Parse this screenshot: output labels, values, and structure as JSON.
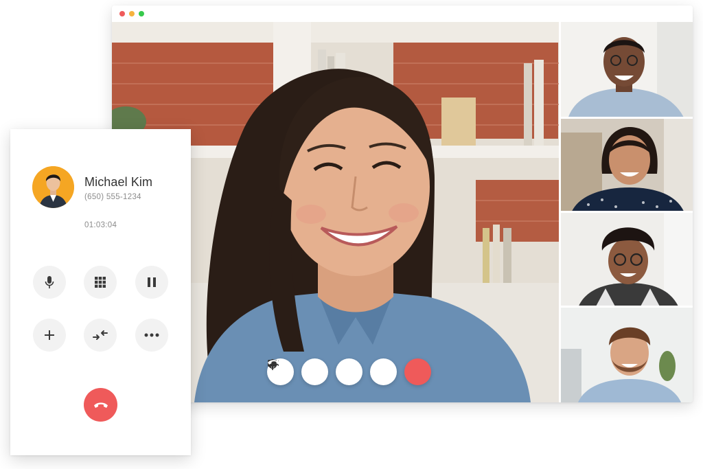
{
  "window": {
    "traffic_lights": [
      {
        "name": "close",
        "color": "#ef5b5b"
      },
      {
        "name": "minimize",
        "color": "#f6b23e"
      },
      {
        "name": "zoom",
        "color": "#37c94c"
      }
    ]
  },
  "video_call": {
    "controls": [
      {
        "name": "mic-icon"
      },
      {
        "name": "video-camera-icon"
      },
      {
        "name": "plus-icon"
      },
      {
        "name": "chat-icon"
      },
      {
        "name": "hang-up-icon"
      }
    ],
    "participants": 4
  },
  "phone_call": {
    "caller": {
      "name": "Michael Kim",
      "number": "(650) 555-1234"
    },
    "timer": "01:03:04",
    "buttons": [
      {
        "name": "mic-icon"
      },
      {
        "name": "dialpad-icon"
      },
      {
        "name": "pause-icon"
      },
      {
        "name": "add-call-icon"
      },
      {
        "name": "merge-calls-icon"
      },
      {
        "name": "more-icon"
      }
    ],
    "end_call": {
      "name": "hang-up-icon"
    }
  },
  "colors": {
    "accent_red": "#ef5a5a",
    "avatar_bg": "#f5a623",
    "button_bg": "#f2f2f2",
    "icon_dark": "#3a3a3a"
  }
}
